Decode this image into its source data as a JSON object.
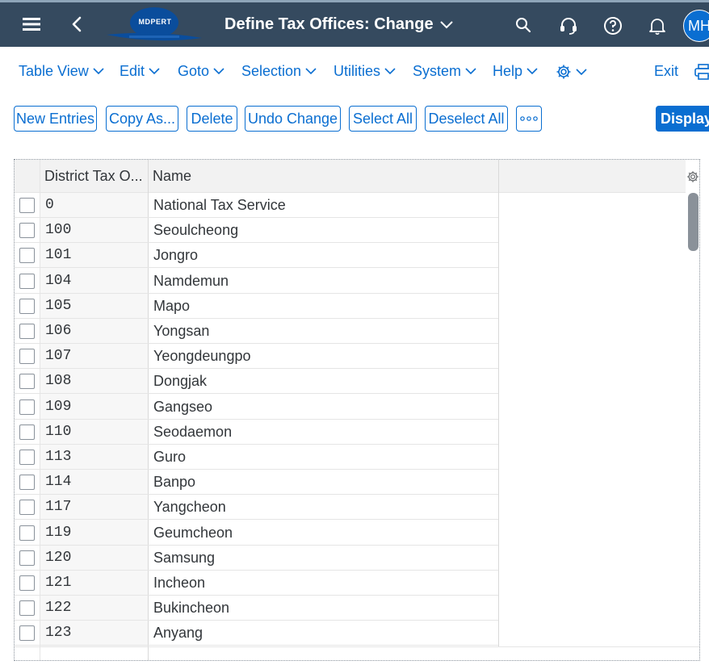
{
  "shell": {
    "logo_text": "MDPERT",
    "title": "Define Tax Offices: Change",
    "avatar_initials": "MH",
    "icons": [
      "menu-icon",
      "back-icon",
      "search-icon",
      "headset-icon",
      "help-icon",
      "notification-icon"
    ]
  },
  "menu": {
    "items": [
      "Table View",
      "Edit",
      "Goto",
      "Selection",
      "Utilities",
      "System",
      "Help"
    ],
    "exit_label": "Exit"
  },
  "toolbar": {
    "new_entries": "New Entries",
    "copy_as": "Copy As...",
    "delete": "Delete",
    "undo_change": "Undo Change",
    "select_all": "Select All",
    "deselect_all": "Deselect All",
    "display": "Display"
  },
  "table": {
    "columns": [
      "District Tax O...",
      "Name"
    ],
    "rows": [
      {
        "code": "0",
        "name": "National Tax Service"
      },
      {
        "code": "100",
        "name": "Seoulcheong"
      },
      {
        "code": "101",
        "name": "Jongro"
      },
      {
        "code": "104",
        "name": "Namdemun"
      },
      {
        "code": "105",
        "name": "Mapo"
      },
      {
        "code": "106",
        "name": "Yongsan"
      },
      {
        "code": "107",
        "name": "Yeongdeungpo"
      },
      {
        "code": "108",
        "name": "Dongjak"
      },
      {
        "code": "109",
        "name": "Gangseo"
      },
      {
        "code": "110",
        "name": "Seodaemon"
      },
      {
        "code": "113",
        "name": "Guro"
      },
      {
        "code": "114",
        "name": "Banpo"
      },
      {
        "code": "117",
        "name": "Yangcheon"
      },
      {
        "code": "119",
        "name": "Geumcheon"
      },
      {
        "code": "120",
        "name": "Samsung"
      },
      {
        "code": "121",
        "name": "Incheon"
      },
      {
        "code": "122",
        "name": "Bukincheon"
      },
      {
        "code": "123",
        "name": "Anyang"
      }
    ]
  },
  "colors": {
    "shell_bg": "#354a5f",
    "accent": "#0a6ed1",
    "text": "#32363a"
  }
}
